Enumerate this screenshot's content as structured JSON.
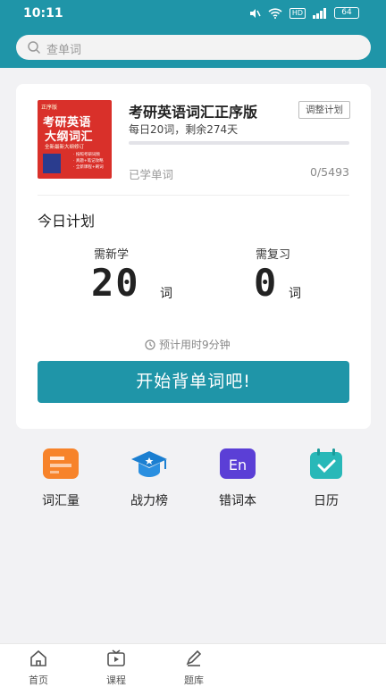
{
  "status": {
    "time": "10:11",
    "battery": "64",
    "hd": "HD"
  },
  "search": {
    "placeholder": "查单词"
  },
  "book": {
    "title": "考研英语词汇正序版",
    "plan_button": "调整计划",
    "daily_info": "每日20词，剩余274天",
    "progress_fraction": 0,
    "learned_label": "已学单词",
    "learned_count": "0/5493",
    "cover": {
      "badge": "正序版",
      "title_line1": "考研英语",
      "title_line2": "大纲词汇",
      "subtitle": "全新最新大纲修订",
      "bullets": [
        "· 按照考研词频",
        "· 真题+笔记攻略",
        "· 全新课程+刷词"
      ]
    }
  },
  "today": {
    "title": "今日计划",
    "new_label": "需新学",
    "new_count": "20",
    "review_label": "需复习",
    "review_count": "0",
    "unit": "词",
    "estimate": "预计用时9分钟"
  },
  "start_button": "开始背单词吧!",
  "features": [
    {
      "label": "词汇量",
      "icon": "vocabulary-icon",
      "color": "#f7832a"
    },
    {
      "label": "战力榜",
      "icon": "graduation-cap-icon",
      "color": "#1b7fd1"
    },
    {
      "label": "错词本",
      "icon": "en-book-icon",
      "color": "#5b3fd6"
    },
    {
      "label": "日历",
      "icon": "calendar-check-icon",
      "color": "#29b8b8"
    }
  ],
  "tabs": [
    {
      "label": "首页",
      "icon": "home-icon"
    },
    {
      "label": "课程",
      "icon": "tv-icon"
    },
    {
      "label": "题库",
      "icon": "pencil-icon"
    }
  ],
  "colors": {
    "accent": "#1f95a8",
    "background": "#f2f2f4"
  }
}
